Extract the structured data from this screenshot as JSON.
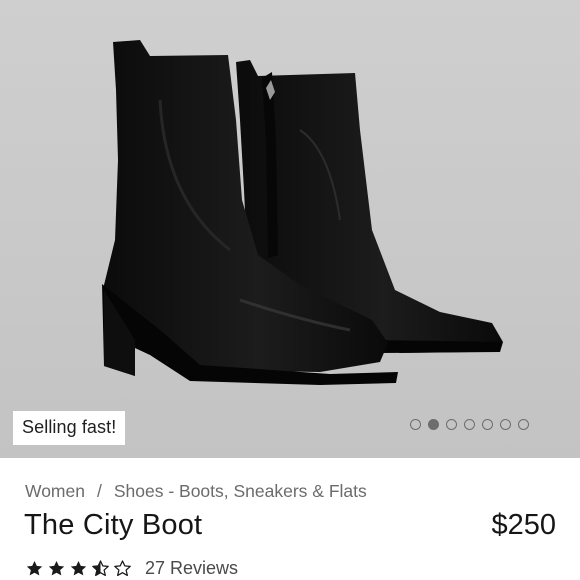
{
  "product": {
    "badge": "Selling fast!",
    "breadcrumb": {
      "items": [
        "Women",
        "Shoes - Boots, Sneakers & Flats"
      ],
      "separator": "/"
    },
    "title": "The City Boot",
    "price": "$250",
    "rating": {
      "value": 3.5,
      "max": 5,
      "reviews_label": "27 Reviews"
    },
    "gallery": {
      "image_count": 7,
      "active_index": 1
    }
  },
  "colors": {
    "hero_background": "#c9c9c9",
    "boot": "#111111",
    "dot": "#6d6d6d",
    "muted_text": "#6b6b6b"
  },
  "icons": {
    "star_full": "star-full-icon",
    "star_half": "star-half-icon",
    "star_empty": "star-empty-icon"
  }
}
